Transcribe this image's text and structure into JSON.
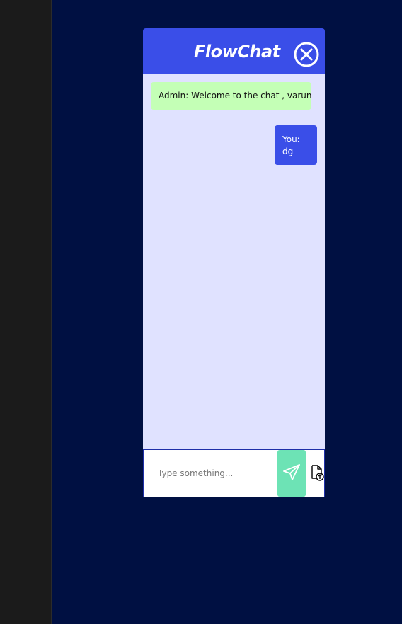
{
  "chat": {
    "title": "FlowChat",
    "messages": [
      {
        "sender": "admin",
        "text": "Admin: Welcome to the chat , varun"
      },
      {
        "sender": "you",
        "label": "You:",
        "text": "dg"
      }
    ]
  },
  "composer": {
    "placeholder": "Type something...",
    "value": ""
  },
  "icons": {
    "close": "close-circle-icon",
    "send": "paper-plane-icon",
    "attach": "file-upload-icon"
  },
  "colors": {
    "page_background": "#001042",
    "header": "#3a4ee8",
    "chat_background": "#e0e2ff",
    "admin_bubble": "#c4ffb6",
    "own_bubble": "#3a4ee8",
    "send_button": "#6de3b5"
  }
}
